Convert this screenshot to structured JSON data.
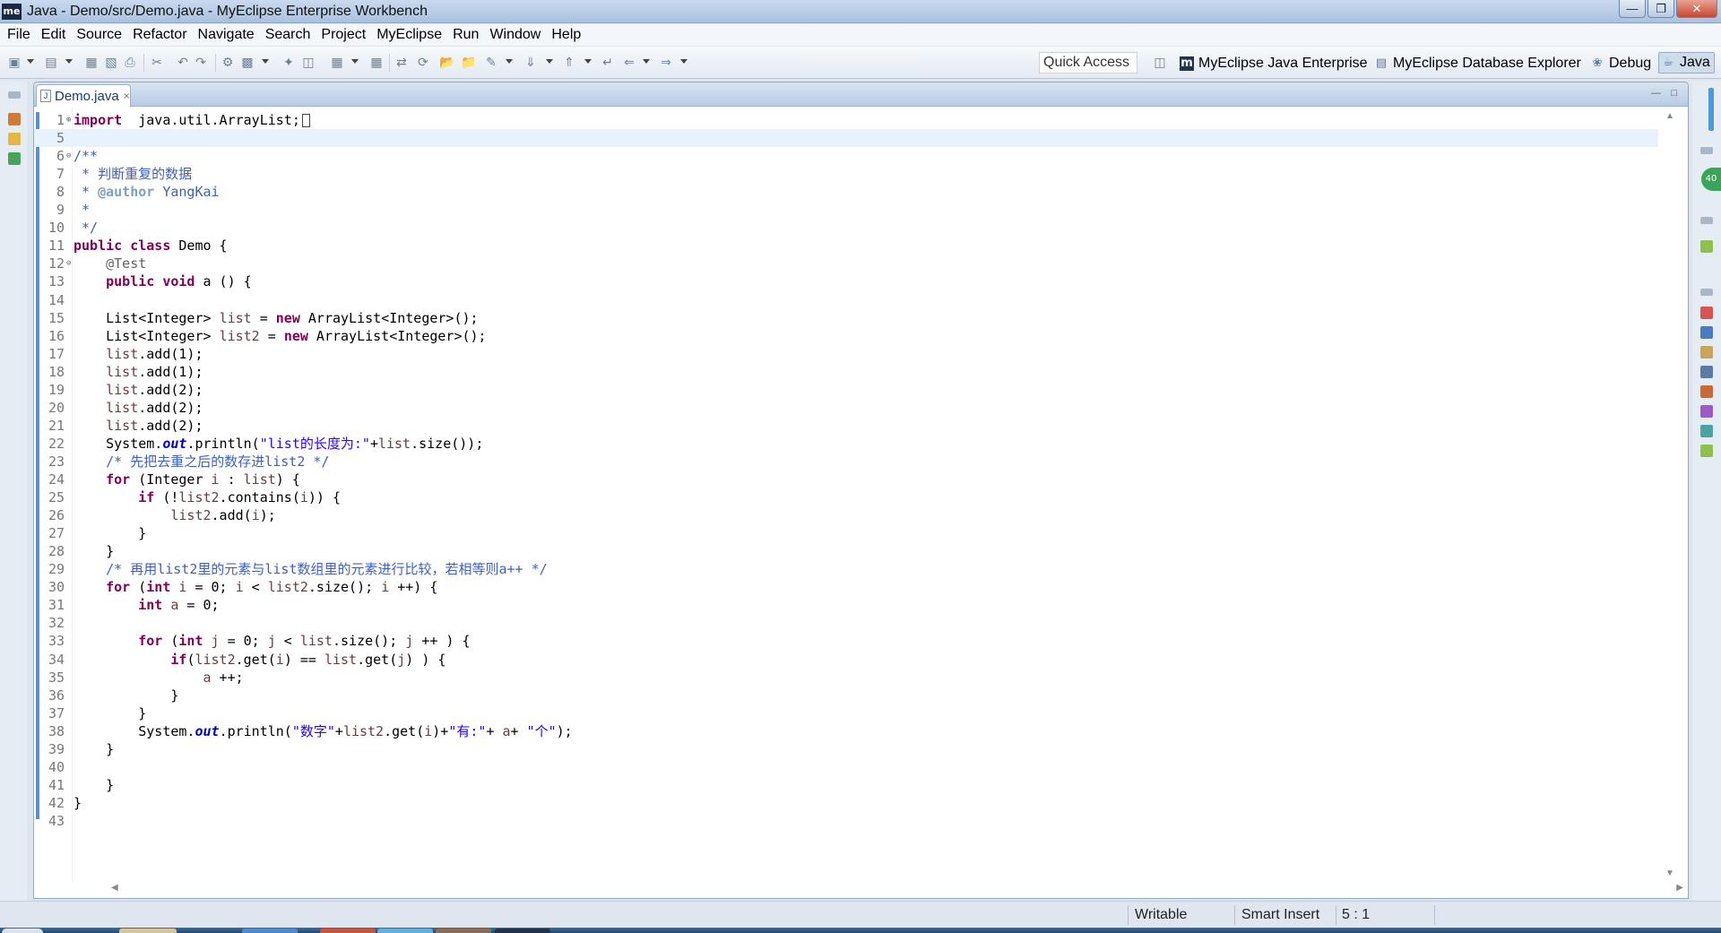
{
  "window": {
    "title": "Java - Demo/src/Demo.java - MyEclipse Enterprise Workbench",
    "app_icon_label": "me",
    "controls": [
      "minimize-icon",
      "maximize-icon",
      "close-icon"
    ]
  },
  "menu": [
    "File",
    "Edit",
    "Source",
    "Refactor",
    "Navigate",
    "Search",
    "Project",
    "MyEclipse",
    "Run",
    "Window",
    "Help"
  ],
  "toolbar": {
    "quick_access": "Quick Access",
    "perspectives": [
      {
        "label": "MyEclipse Java Enterprise",
        "icon": "me-perspective-icon"
      },
      {
        "label": "MyEclipse Database Explorer",
        "icon": "database-icon"
      },
      {
        "label": "Debug",
        "icon": "bug-icon"
      },
      {
        "label": "Java",
        "icon": "java-perspective-icon",
        "active": true
      }
    ]
  },
  "editor": {
    "tab": {
      "title": "Demo.java"
    },
    "lines": [
      {
        "n": "1",
        "fold": "plus",
        "tokens": [
          [
            "kw",
            "import"
          ],
          [
            "",
            "  java.util.ArrayList;"
          ]
        ],
        "cursor": true
      },
      {
        "n": "5",
        "current": true,
        "tokens": []
      },
      {
        "n": "6",
        "fold": "minus",
        "tokens": [
          [
            "cm",
            "/**"
          ]
        ]
      },
      {
        "n": "7",
        "tokens": [
          [
            "cm",
            " * 判断重复的数据"
          ]
        ]
      },
      {
        "n": "8",
        "tokens": [
          [
            "cm",
            " * "
          ],
          [
            "jd",
            "@author"
          ],
          [
            "cm",
            " YangKai"
          ]
        ]
      },
      {
        "n": "9",
        "tokens": [
          [
            "cm",
            " *"
          ]
        ]
      },
      {
        "n": "10",
        "tokens": [
          [
            "cm",
            " */"
          ]
        ]
      },
      {
        "n": "11",
        "tokens": [
          [
            "kw",
            "public"
          ],
          [
            "",
            " "
          ],
          [
            "kw",
            "class"
          ],
          [
            "",
            " Demo {"
          ]
        ]
      },
      {
        "n": "12",
        "fold": "minus",
        "tokens": [
          [
            "",
            "    "
          ],
          [
            "an",
            "@Test"
          ]
        ]
      },
      {
        "n": "13",
        "tokens": [
          [
            "",
            "    "
          ],
          [
            "kw",
            "public"
          ],
          [
            "",
            " "
          ],
          [
            "kw",
            "void"
          ],
          [
            "",
            " a () {"
          ]
        ]
      },
      {
        "n": "14",
        "tokens": []
      },
      {
        "n": "15",
        "tokens": [
          [
            "",
            "    List<Integer> "
          ],
          [
            "lv",
            "list"
          ],
          [
            "",
            " = "
          ],
          [
            "kw",
            "new"
          ],
          [
            "",
            " ArrayList<Integer>();"
          ]
        ]
      },
      {
        "n": "16",
        "tokens": [
          [
            "",
            "    List<Integer> "
          ],
          [
            "lv",
            "list2"
          ],
          [
            "",
            " = "
          ],
          [
            "kw",
            "new"
          ],
          [
            "",
            " ArrayList<Integer>();"
          ]
        ]
      },
      {
        "n": "17",
        "tokens": [
          [
            "",
            "    "
          ],
          [
            "lv",
            "list"
          ],
          [
            "",
            ".add(1);"
          ]
        ]
      },
      {
        "n": "18",
        "tokens": [
          [
            "",
            "    "
          ],
          [
            "lv",
            "list"
          ],
          [
            "",
            ".add(1);"
          ]
        ]
      },
      {
        "n": "19",
        "tokens": [
          [
            "",
            "    "
          ],
          [
            "lv",
            "list"
          ],
          [
            "",
            ".add(2);"
          ]
        ]
      },
      {
        "n": "20",
        "tokens": [
          [
            "",
            "    "
          ],
          [
            "lv",
            "list"
          ],
          [
            "",
            ".add(2);"
          ]
        ]
      },
      {
        "n": "21",
        "tokens": [
          [
            "",
            "    "
          ],
          [
            "lv",
            "list"
          ],
          [
            "",
            ".add(2);"
          ]
        ]
      },
      {
        "n": "22",
        "tokens": [
          [
            "",
            "    System."
          ],
          [
            "sf",
            "out"
          ],
          [
            "",
            ".println("
          ],
          [
            "st",
            "\"list的长度为:\""
          ],
          [
            "",
            "+"
          ],
          [
            "lv",
            "list"
          ],
          [
            "",
            ".size());"
          ]
        ]
      },
      {
        "n": "23",
        "tokens": [
          [
            "",
            "    "
          ],
          [
            "cm",
            "/* 先把去重之后的数存进list2 */"
          ]
        ]
      },
      {
        "n": "24",
        "tokens": [
          [
            "",
            "    "
          ],
          [
            "kw",
            "for"
          ],
          [
            "",
            " (Integer "
          ],
          [
            "lv",
            "i"
          ],
          [
            "",
            " : "
          ],
          [
            "lv",
            "list"
          ],
          [
            "",
            ") {"
          ]
        ]
      },
      {
        "n": "25",
        "tokens": [
          [
            "",
            "        "
          ],
          [
            "kw",
            "if"
          ],
          [
            "",
            " (!"
          ],
          [
            "lv",
            "list2"
          ],
          [
            "",
            ".contains("
          ],
          [
            "lv",
            "i"
          ],
          [
            "",
            ")) {"
          ]
        ]
      },
      {
        "n": "26",
        "tokens": [
          [
            "",
            "            "
          ],
          [
            "lv",
            "list2"
          ],
          [
            "",
            ".add("
          ],
          [
            "lv",
            "i"
          ],
          [
            "",
            ");"
          ]
        ]
      },
      {
        "n": "27",
        "tokens": [
          [
            "",
            "        }"
          ]
        ]
      },
      {
        "n": "28",
        "tokens": [
          [
            "",
            "    }"
          ]
        ]
      },
      {
        "n": "29",
        "tokens": [
          [
            "",
            "    "
          ],
          [
            "cm",
            "/* 再用list2里的元素与list数组里的元素进行比较，若相等则a++ */"
          ]
        ]
      },
      {
        "n": "30",
        "tokens": [
          [
            "",
            "    "
          ],
          [
            "kw",
            "for"
          ],
          [
            "",
            " ("
          ],
          [
            "kw",
            "int"
          ],
          [
            "",
            " "
          ],
          [
            "lv",
            "i"
          ],
          [
            "",
            " = 0; "
          ],
          [
            "lv",
            "i"
          ],
          [
            "",
            " < "
          ],
          [
            "lv",
            "list2"
          ],
          [
            "",
            ".size(); "
          ],
          [
            "lv",
            "i"
          ],
          [
            "",
            " ++) {"
          ]
        ]
      },
      {
        "n": "31",
        "tokens": [
          [
            "",
            "        "
          ],
          [
            "kw",
            "int"
          ],
          [
            "",
            " "
          ],
          [
            "lv",
            "a"
          ],
          [
            "",
            " = 0;"
          ]
        ]
      },
      {
        "n": "32",
        "tokens": []
      },
      {
        "n": "33",
        "tokens": [
          [
            "",
            "        "
          ],
          [
            "kw",
            "for"
          ],
          [
            "",
            " ("
          ],
          [
            "kw",
            "int"
          ],
          [
            "",
            " "
          ],
          [
            "lv",
            "j"
          ],
          [
            "",
            " = 0; "
          ],
          [
            "lv",
            "j"
          ],
          [
            "",
            " < "
          ],
          [
            "lv",
            "list"
          ],
          [
            "",
            ".size(); "
          ],
          [
            "lv",
            "j"
          ],
          [
            "",
            " ++ ) {"
          ]
        ]
      },
      {
        "n": "34",
        "tokens": [
          [
            "",
            "            "
          ],
          [
            "kw",
            "if"
          ],
          [
            "",
            "("
          ],
          [
            "lv",
            "list2"
          ],
          [
            "",
            ".get("
          ],
          [
            "lv",
            "i"
          ],
          [
            "",
            ") == "
          ],
          [
            "lv",
            "list"
          ],
          [
            "",
            ".get("
          ],
          [
            "lv",
            "j"
          ],
          [
            "",
            ") ) {"
          ]
        ]
      },
      {
        "n": "35",
        "tokens": [
          [
            "",
            "                "
          ],
          [
            "lv",
            "a"
          ],
          [
            "",
            " ++;"
          ]
        ]
      },
      {
        "n": "36",
        "tokens": [
          [
            "",
            "            }"
          ]
        ]
      },
      {
        "n": "37",
        "tokens": [
          [
            "",
            "        }"
          ]
        ]
      },
      {
        "n": "38",
        "tokens": [
          [
            "",
            "        System."
          ],
          [
            "sf",
            "out"
          ],
          [
            "",
            ".println("
          ],
          [
            "st",
            "\"数字\""
          ],
          [
            "",
            "+"
          ],
          [
            "lv",
            "list2"
          ],
          [
            "",
            ".get("
          ],
          [
            "lv",
            "i"
          ],
          [
            "",
            ")+"
          ],
          [
            "st",
            "\"有:\""
          ],
          [
            "",
            "+ "
          ],
          [
            "lv",
            "a"
          ],
          [
            "",
            "+ "
          ],
          [
            "st",
            "\"个\""
          ],
          [
            "",
            ");"
          ]
        ]
      },
      {
        "n": "39",
        "tokens": [
          [
            "",
            "    }"
          ]
        ]
      },
      {
        "n": "40",
        "tokens": []
      },
      {
        "n": "41",
        "tokens": [
          [
            "",
            "    }"
          ]
        ]
      },
      {
        "n": "42",
        "tokens": [
          [
            "",
            "}"
          ]
        ]
      },
      {
        "n": "43",
        "tokens": []
      }
    ]
  },
  "status": {
    "writable": "Writable",
    "insert_mode": "Smart Insert",
    "position": "5 : 1"
  }
}
